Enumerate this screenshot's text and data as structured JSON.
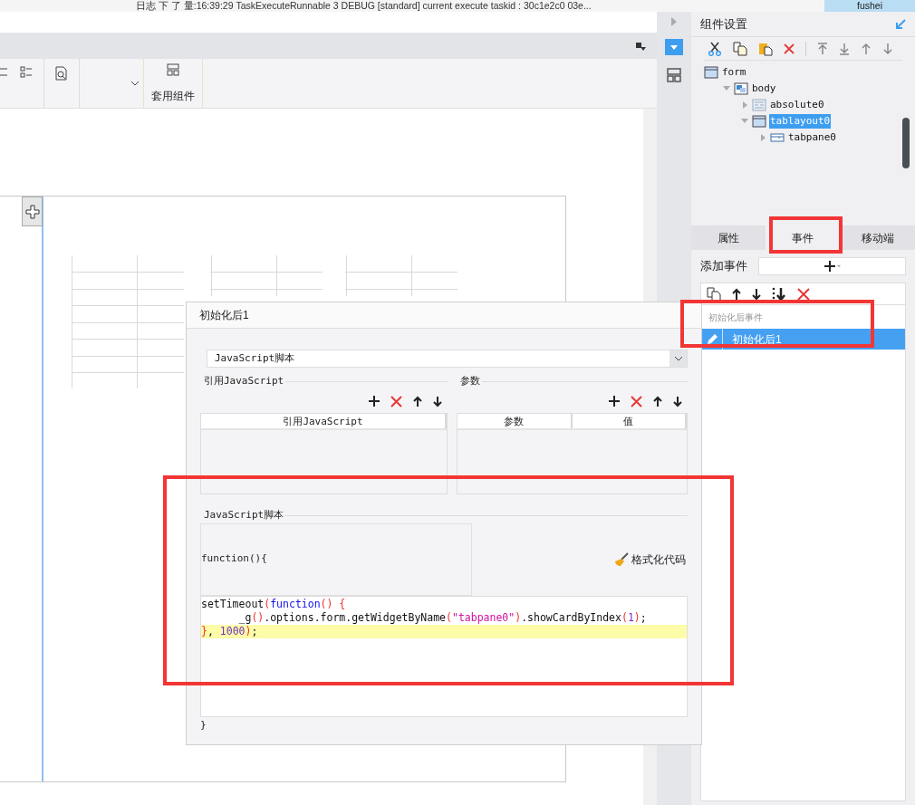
{
  "log_bar": {
    "text": "日志 下 了 量:16:39:29 TaskExecuteRunnable 3 DEBUG [standard] current execute taskid : 30c1e2c0 03e...",
    "user": "fushei"
  },
  "ribbon": {
    "group_label": "套用组件"
  },
  "component_panel": {
    "title": "组件设置",
    "tree": [
      {
        "label": "form",
        "kind": "form",
        "selected": false,
        "children": [
          {
            "label": "body",
            "kind": "body",
            "expanded": true,
            "selected": false,
            "children": [
              {
                "label": "absolute0",
                "kind": "absolute",
                "expanded": false,
                "selected": false
              },
              {
                "label": "tablayout0",
                "kind": "tablayout",
                "expanded": true,
                "selected": true,
                "children": [
                  {
                    "label": "tabpane0",
                    "kind": "tabpane",
                    "expanded": false,
                    "selected": false
                  }
                ]
              }
            ]
          }
        ]
      }
    ]
  },
  "tabs": [
    {
      "label": "属性",
      "selected": false
    },
    {
      "label": "事件",
      "selected": true
    },
    {
      "label": "移动端",
      "selected": false
    }
  ],
  "add_event": {
    "label": "添加事件"
  },
  "event_list": {
    "group": "初始化后事件",
    "items": [
      {
        "label": "初始化后1",
        "selected": true
      }
    ]
  },
  "dialog": {
    "title": "初始化后1",
    "type_select": "JavaScript脚本",
    "ref_section": {
      "title": "引用JavaScript",
      "columns": [
        "引用JavaScript"
      ]
    },
    "param_section": {
      "title": "参数",
      "columns": [
        "参数",
        "值"
      ]
    },
    "script_section": {
      "title": "JavaScript脚本",
      "header": "function(){",
      "format_button": "格式化代码",
      "lines": [
        {
          "highlighted": false,
          "tokens": [
            {
              "kind": "plain",
              "text": "setTimeout"
            },
            {
              "kind": "paren",
              "text": "("
            },
            {
              "kind": "keyword",
              "text": "function"
            },
            {
              "kind": "paren",
              "text": "() {"
            }
          ]
        },
        {
          "highlighted": false,
          "tokens": [
            {
              "kind": "plain",
              "text": "      _g"
            },
            {
              "kind": "paren",
              "text": "()"
            },
            {
              "kind": "plain",
              "text": ".options.form.getWidgetByName"
            },
            {
              "kind": "paren",
              "text": "("
            },
            {
              "kind": "string",
              "text": "\"tabpane0\""
            },
            {
              "kind": "paren",
              "text": ")"
            },
            {
              "kind": "plain",
              "text": ".showCardByIndex"
            },
            {
              "kind": "paren",
              "text": "("
            },
            {
              "kind": "number",
              "text": "1"
            },
            {
              "kind": "paren",
              "text": ")"
            },
            {
              "kind": "plain",
              "text": ";"
            }
          ]
        },
        {
          "highlighted": true,
          "tokens": [
            {
              "kind": "paren",
              "text": "}"
            },
            {
              "kind": "plain",
              "text": ", "
            },
            {
              "kind": "number",
              "text": "1000"
            },
            {
              "kind": "paren",
              "text": ")"
            },
            {
              "kind": "plain",
              "text": ";"
            }
          ]
        }
      ],
      "footer": "}"
    }
  }
}
